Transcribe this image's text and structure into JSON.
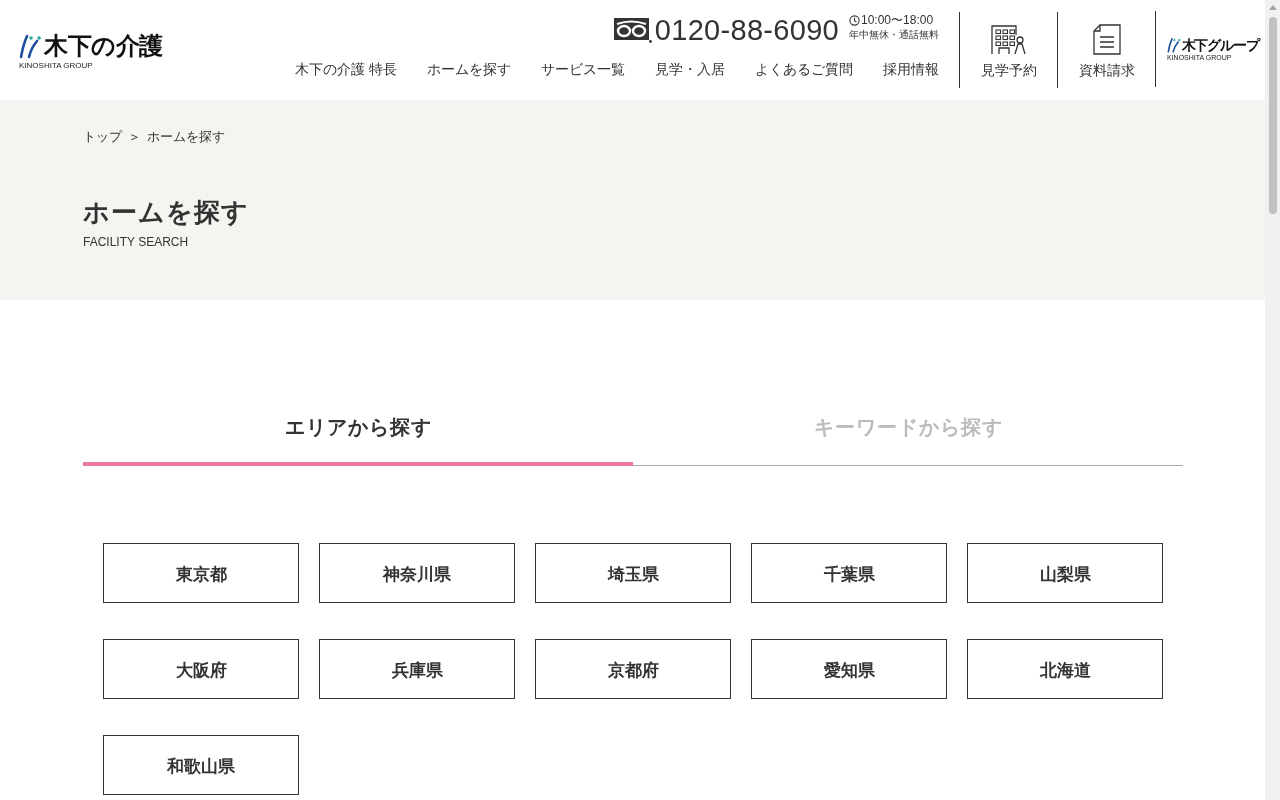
{
  "header": {
    "logo": {
      "name": "木下の介護",
      "subtitle": "KINOSHITA GROUP"
    },
    "phone": {
      "number": "0120-88-6090",
      "hours": "10:00〜18:00",
      "note": "年中無休・通話無料"
    },
    "nav": [
      {
        "label": "木下の介護 特長"
      },
      {
        "label": "ホームを探す"
      },
      {
        "label": "サービス一覧"
      },
      {
        "label": "見学・入居"
      },
      {
        "label": "よくあるご質問"
      },
      {
        "label": "採用情報"
      }
    ],
    "actions": [
      {
        "kind": "visit",
        "label": "見学予約"
      },
      {
        "kind": "document",
        "label": "資料請求"
      }
    ],
    "group_logo": {
      "name": "木下グループ",
      "subtitle": "KINOSHITA GROUP"
    }
  },
  "breadcrumb": {
    "items": [
      "トップ",
      "ホームを探す"
    ],
    "separator": "＞"
  },
  "page_heading": {
    "title": "ホームを探す",
    "subtitle": "FACILITY SEARCH"
  },
  "tabs": [
    {
      "label": "エリアから探す",
      "selected": true
    },
    {
      "label": "キーワードから探す",
      "selected": false
    }
  ],
  "areas": [
    "東京都",
    "神奈川県",
    "埼玉県",
    "千葉県",
    "山梨県",
    "大阪府",
    "兵庫県",
    "京都府",
    "愛知県",
    "北海道",
    "和歌山県"
  ]
}
